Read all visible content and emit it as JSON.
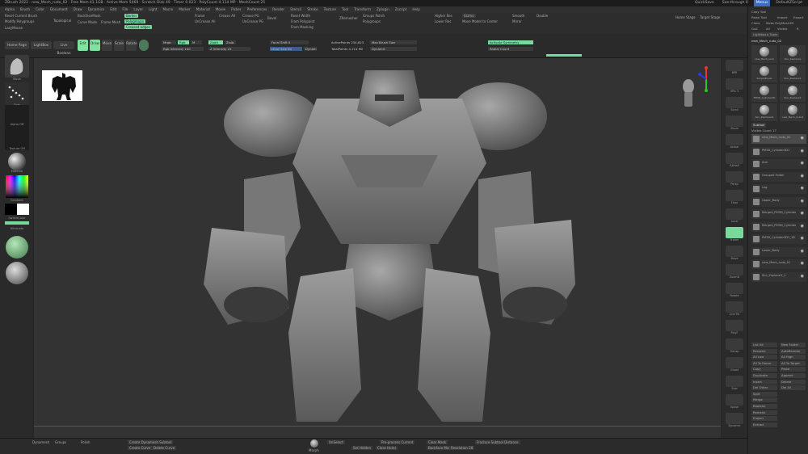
{
  "titlebar": {
    "text": "ZBrush 2022  ·  new_Mech_rudo_02  ·  Free Mem 41.1GB  ·  Active Mem 5469  ·  Scratch Disk 49  ·  Timer 0.023  ·  PolyCount 4.114 MP  ·  MeshCount 25",
    "right_items": [
      "QuickSave",
      "See-through 0",
      "Menus",
      "DefaultZScript"
    ]
  },
  "menubar": {
    "items": [
      "Alpha",
      "Brush",
      "Color",
      "Document",
      "Draw",
      "Dynamics",
      "Edit",
      "File",
      "Layer",
      "Light",
      "Macro",
      "Marker",
      "Material",
      "Movie",
      "Picker",
      "Preferences",
      "Render",
      "Stencil",
      "Stroke",
      "Texture",
      "Tool",
      "Transform",
      "Zplugin",
      "Zscript",
      "Help"
    ]
  },
  "toolrow": {
    "items": [
      {
        "label": "Reset Current Brush"
      },
      {
        "label": "Modify Polygroups"
      },
      {
        "label": "LazyMouse"
      },
      {
        "label": "BackfaceMask"
      },
      {
        "label": "Curve Mode"
      },
      {
        "label": "Frame Mesh"
      },
      {
        "label": "Topological"
      },
      {
        "label": "Border"
      },
      {
        "label": "Polygroups"
      },
      {
        "label": "Creased edges"
      },
      {
        "label": "Frame"
      },
      {
        "label": "Crease All"
      },
      {
        "label": "UnCrease All"
      },
      {
        "label": "Crease PG"
      },
      {
        "label": "UnCrease PG"
      },
      {
        "label": "Bevel"
      },
      {
        "label": "Reset Width"
      },
      {
        "label": "From Polypaint"
      },
      {
        "label": "From Masking"
      },
      {
        "label": "ZRemesher"
      },
      {
        "label": "Groups Polish"
      },
      {
        "label": "Polygroups"
      },
      {
        "label": "Higher Res"
      },
      {
        "label": "Lower Res"
      },
      {
        "label": "Gizmo"
      },
      {
        "label": "Smooth"
      },
      {
        "label": "Double"
      },
      {
        "label": "Mirror"
      },
      {
        "label": "Move Model to Center"
      },
      {
        "label": "Home Stage"
      },
      {
        "label": "Target Stage"
      }
    ]
  },
  "shelf": {
    "buttons": [
      "Home Page",
      "LightBox",
      "Live Boolean",
      "Edit",
      "Draw",
      "Move",
      "Scale",
      "Rotate"
    ],
    "sliders": [
      {
        "label": "Mrgb",
        "value": ""
      },
      {
        "label": "Rgb",
        "value": ""
      },
      {
        "label": "M",
        "value": ""
      },
      {
        "label": "Zadd",
        "value": ""
      },
      {
        "label": "Zsub",
        "value": ""
      },
      {
        "label": "Focal Shift",
        "value": "0"
      },
      {
        "label": "Draw Size",
        "value": "64"
      },
      {
        "label": "Dynamic",
        "value": ""
      },
      {
        "label": "Rgb Intensity",
        "value": "100"
      },
      {
        "label": "Z Intensity",
        "value": "25"
      },
      {
        "label": "ActivePoints",
        "value": "234,823"
      },
      {
        "label": "TotalPoints",
        "value": "4.114 Mil"
      },
      {
        "label": "Max Brush Size",
        "value": ""
      },
      {
        "label": "Dynamic",
        "value": ""
      },
      {
        "label": "Activate Symmetry",
        "value": ""
      },
      {
        "label": "Radial Count",
        "value": ""
      }
    ]
  },
  "leftbar": {
    "items": [
      "Move",
      "Dots",
      "Alpha Off",
      "Texture Off",
      "Material",
      "Gradient",
      "SwitchColor",
      "Alternate"
    ]
  },
  "navbar": {
    "items": [
      "BPR",
      "SPix 3",
      "Scroll",
      "Zoom",
      "Actual",
      "AAHalf",
      "Persp",
      "Floor",
      "Local",
      "Frame",
      "Move",
      "ZoomD",
      "Rotate",
      "Line Fill",
      "PolyF",
      "Transp",
      "Ghost",
      "Solo",
      "Xpose",
      "Dynamic"
    ]
  },
  "rightpanel": {
    "header_items": [
      "Copy Tool",
      "Paste Tool",
      "Import",
      "Export",
      "Clone",
      "Make PolyMesh3D",
      "GoZ",
      "All",
      "Visible",
      "R"
    ],
    "lightbox_label": "Lightbox ▸ Tools",
    "tool_name": "new_Mech_rudo_02",
    "tool_thumbs": [
      "new_Mech_rudo",
      "Sini_Zspheres",
      "SimpleBrush",
      "Sini_Zsphere1",
      "PM3D_Cylinder3D",
      "Sini_Zsphere2",
      "Sini_Zspheres4",
      "new_Mech_rudo3"
    ],
    "subtool_label": "Subtool",
    "visible_count": "Visible Count 17",
    "subtools": [
      "new_Mech_rudo_02",
      "PM3D_Cylinder3D1",
      "Arm",
      "Grouped Folder",
      "Leg",
      "Upper_Body",
      "Merged_PM3D_Cylinder3D1",
      "Merged_PM3D_Cylinder3D3",
      "PM3D_Cylinder3D1_18",
      "Lower_Body",
      "new_Mech_rudo_01",
      "Sini_Zsphere1_1"
    ],
    "footer_items": [
      "List All",
      "New Folder",
      "Rename",
      "AutoReorder",
      "All Low",
      "All High",
      "All To Home",
      "All To Target",
      "Copy",
      "Paste",
      "Duplicate",
      "Append",
      "Insert",
      "Delete",
      "Del Other",
      "Del All",
      "Split",
      "Merge",
      "Boolean",
      "Remesh",
      "Project",
      "Extract"
    ]
  },
  "bottombar": {
    "items": [
      "Dynamesh",
      "Groups",
      "Polish",
      "Create Dynamesh Subtool",
      "Create Curve",
      "Delete Curve",
      "Morph",
      "UnSelect",
      "Set Hidden",
      "Close Holes",
      "Pre-process Current",
      "Clear Mask",
      "Backface Mask",
      "Resolution 28",
      "Fracture Subtool Distance"
    ]
  },
  "viewport": {
    "model": "mech robot",
    "orientation_label": "XYZ"
  }
}
